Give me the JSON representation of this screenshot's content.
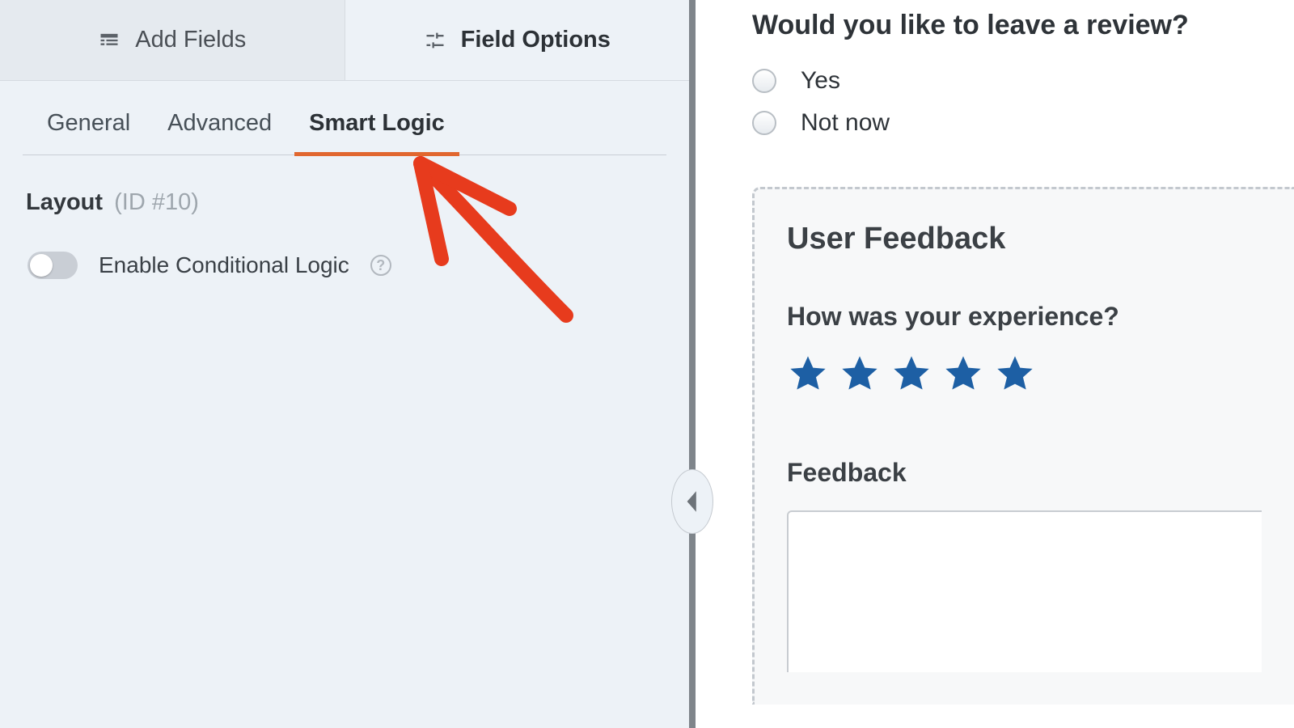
{
  "colors": {
    "accent": "#e1672f",
    "star": "#1d5fa4"
  },
  "top_tabs": {
    "add_fields": "Add Fields",
    "field_options": "Field Options"
  },
  "sub_tabs": {
    "general": "General",
    "advanced": "Advanced",
    "smart_logic": "Smart Logic"
  },
  "field_meta": {
    "title": "Layout",
    "id_label": "(ID #10)"
  },
  "toggle": {
    "label": "Enable Conditional Logic",
    "help_glyph": "?"
  },
  "preview": {
    "review_q": "Would you like to leave a review?",
    "options": {
      "yes": "Yes",
      "not_now": "Not now"
    },
    "section_title": "User Feedback",
    "experience_q": "How was your experience?",
    "star_count": 5,
    "feedback_label": "Feedback"
  }
}
